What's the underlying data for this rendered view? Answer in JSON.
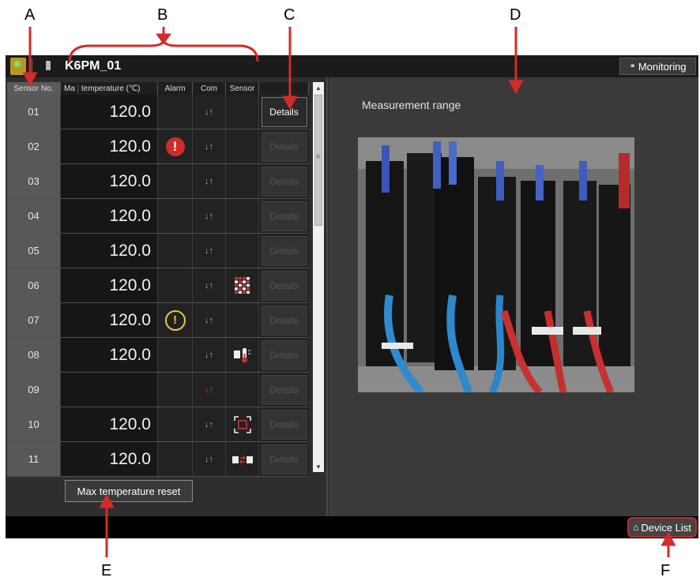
{
  "callouts": {
    "a": "A",
    "b": "B",
    "c": "C",
    "d": "D",
    "e": "E",
    "f": "F"
  },
  "header": {
    "device_name": "K6PM_01",
    "monitoring_label": "Monitoring"
  },
  "table": {
    "columns": {
      "sensor_no": "Sensor No.",
      "max_temp_prefix": "Ma",
      "temp": "temperature (℃)",
      "alarm": "Alarm",
      "com": "Com",
      "sensor": "Sensor"
    },
    "rows": [
      {
        "no": "01",
        "temp": "120.0",
        "alarm": "none",
        "com": "ok",
        "sensor": "none",
        "details": "Details",
        "details_enabled": true
      },
      {
        "no": "02",
        "temp": "120.0",
        "alarm": "critical",
        "com": "ok",
        "sensor": "none",
        "details": "Details",
        "details_enabled": false
      },
      {
        "no": "03",
        "temp": "120.0",
        "alarm": "none",
        "com": "ok",
        "sensor": "none",
        "details": "Details",
        "details_enabled": false
      },
      {
        "no": "04",
        "temp": "120.0",
        "alarm": "none",
        "com": "ok",
        "sensor": "none",
        "details": "Details",
        "details_enabled": false
      },
      {
        "no": "05",
        "temp": "120.0",
        "alarm": "none",
        "com": "ok",
        "sensor": "none",
        "details": "Details",
        "details_enabled": false
      },
      {
        "no": "06",
        "temp": "120.0",
        "alarm": "none",
        "com": "ok",
        "sensor": "grid-error-icon",
        "details": "Details",
        "details_enabled": false
      },
      {
        "no": "07",
        "temp": "120.0",
        "alarm": "warning",
        "com": "ok",
        "sensor": "none",
        "details": "Details",
        "details_enabled": false
      },
      {
        "no": "08",
        "temp": "120.0",
        "alarm": "none",
        "com": "ok",
        "sensor": "temperature-error-icon",
        "details": "Details",
        "details_enabled": false
      },
      {
        "no": "09",
        "temp": "",
        "alarm": "none",
        "com": "error",
        "sensor": "none",
        "details": "Details",
        "details_enabled": false
      },
      {
        "no": "10",
        "temp": "120.0",
        "alarm": "none",
        "com": "ok",
        "sensor": "focus-error-icon",
        "details": "Details",
        "details_enabled": false
      },
      {
        "no": "11",
        "temp": "120.0",
        "alarm": "none",
        "com": "ok",
        "sensor": "connection-error-icon",
        "details": "Details",
        "details_enabled": false
      }
    ],
    "scroll_up": "▲",
    "scroll_down": "▼",
    "scroll_mid": "≡"
  },
  "reset_label": "Max temperature reset",
  "measurement": {
    "label": "Measurement range"
  },
  "footer": {
    "device_list_label": "Device List"
  },
  "colors": {
    "com_ok": "#7ed04c",
    "com_error": "#e13c3c",
    "alarm_critical": "#d02b2b",
    "alarm_warning": "#e6c44a",
    "sensor_icon_red": "#c83232"
  }
}
